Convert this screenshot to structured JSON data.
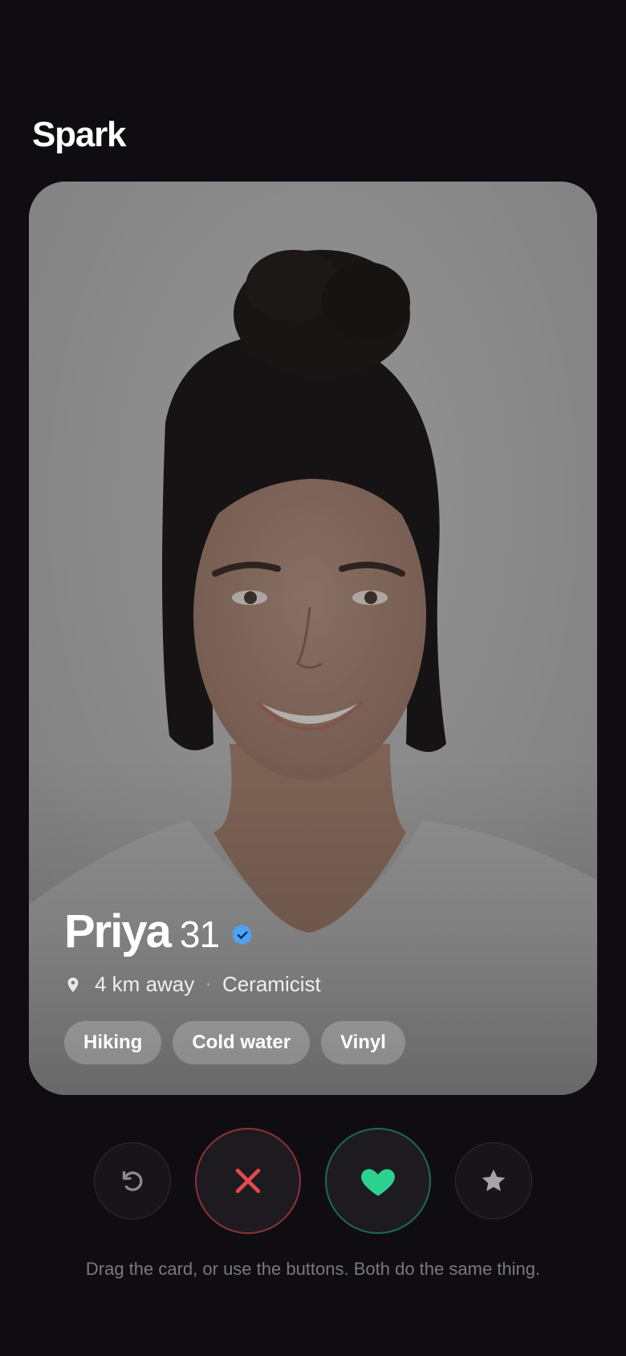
{
  "app": {
    "title": "Spark"
  },
  "profile": {
    "name": "Priya",
    "age": "31",
    "verified": true,
    "distance": "4 km away",
    "separator": "·",
    "occupation": "Ceramicist",
    "tags": [
      "Hiking",
      "Cold water",
      "Vinyl"
    ]
  },
  "actions": [
    {
      "name": "rewind",
      "icon": "undo-icon"
    },
    {
      "name": "nope",
      "icon": "close-icon",
      "color": "#e5484d"
    },
    {
      "name": "like",
      "icon": "heart-icon",
      "color": "#2dd28f"
    },
    {
      "name": "super-like",
      "icon": "star-icon",
      "color": "#a6a3ab"
    }
  ],
  "hint": "Drag the card, or use the buttons. Both do the same thing.",
  "colors": {
    "background": "#0f0d12",
    "verified": "#4da3f7",
    "nope": "#e5484d",
    "like": "#2dd28f"
  }
}
